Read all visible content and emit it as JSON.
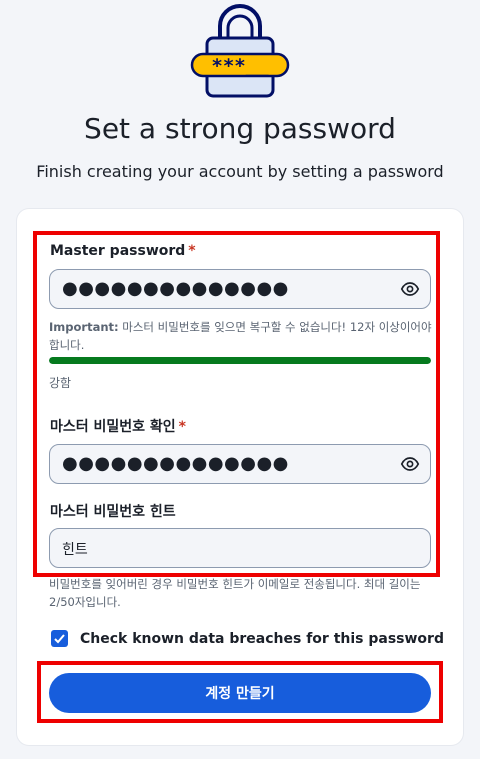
{
  "header": {
    "logo_text": "***__",
    "title": "Set a strong password",
    "subtitle": "Finish creating your account by setting a password"
  },
  "form": {
    "master_password": {
      "label": "Master password",
      "required_mark": "*",
      "value": "●●●●●●●●●●●●●●",
      "help_strong": "Important:",
      "help_text": "마스터 비밀번호를 잊으면 복구할 수 없습니다! 12자 이상이어야 합니다.",
      "strength_fraction": 1.0,
      "strength_color": "#067a1e",
      "strength_label": "강함"
    },
    "confirm_password": {
      "label": "마스터 비밀번호 확인",
      "required_mark": "*",
      "value": "●●●●●●●●●●●●●●"
    },
    "hint": {
      "label": "마스터 비밀번호 힌트",
      "value": "힌트",
      "help_text": "비밀번호를 잊어버린 경우 비밀번호 힌트가 이메일로 전송됩니다. 최대 길이는 2/50자입니다."
    },
    "breach_check": {
      "label": "Check known data breaches for this password",
      "checked": true
    },
    "submit_label": "계정 만들기"
  },
  "icons": {
    "lock": "lock-icon",
    "eye": "eye-icon",
    "check": "check-icon"
  },
  "colors": {
    "primary": "#175ddc",
    "success": "#067a1e",
    "required": "#c83522",
    "highlight": "#ee0000",
    "logo_yellow": "#ffbf00"
  }
}
